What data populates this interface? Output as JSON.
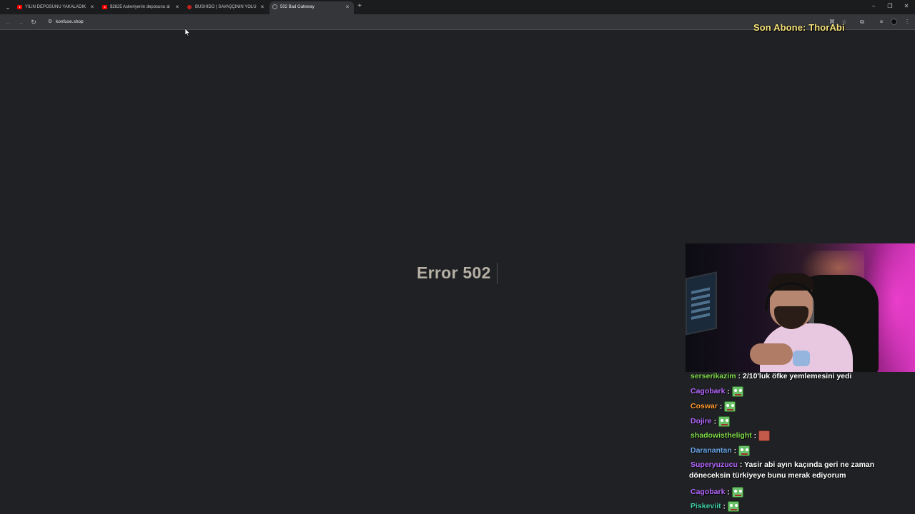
{
  "browser": {
    "tabs": [
      {
        "title": "YILIN DEPOSUNU YAKALADIK /",
        "favicon": "youtube-icon",
        "active": false
      },
      {
        "title": "$2625 Askeriyenin deposunu al",
        "favicon": "youtube-icon",
        "active": false
      },
      {
        "title": "BUSHIDO | SAVAŞÇININ YOLU |",
        "favicon": "red-circle-icon",
        "active": false
      },
      {
        "title": "502 Bad Gateway",
        "favicon": "globe-icon",
        "active": true
      }
    ],
    "new_tab_symbol": "+",
    "tab_close_symbol": "×",
    "address": "konfuse.shop",
    "window_controls": {
      "minimize": "–",
      "restore": "❐",
      "close": "✕"
    }
  },
  "overlay": {
    "sub_banner": "Son Abone: ThorAbi"
  },
  "page": {
    "error_text": "Error 502"
  },
  "chat": {
    "messages": [
      {
        "user": "serserikazim",
        "color": "#7fdc4a",
        "text": "2/10'luk öfke yemlemesini yedi",
        "emote": null
      },
      {
        "user": "Cagobark",
        "color": "#b366ff",
        "text": "",
        "emote": "pepe"
      },
      {
        "user": "Coswar",
        "color": "#ff9a2e",
        "text": "",
        "emote": "pepe"
      },
      {
        "user": "Dojire",
        "color": "#b366ff",
        "text": "",
        "emote": "pepe"
      },
      {
        "user": "shadowisthelight",
        "color": "#7fdc4a",
        "text": "",
        "emote": "meat"
      },
      {
        "user": "Daranantan",
        "color": "#6aa7e8",
        "text": "",
        "emote": "pepe"
      },
      {
        "user": "Superyuzucu",
        "color": "#b366ff",
        "text": "Yasir abi ayın kaçında geri ne zaman",
        "text2": "döneceksin türkiyeye bunu merak ediyorum",
        "emote": null
      },
      {
        "user": "Cagobark",
        "color": "#b366ff",
        "text": "",
        "emote": "pepe"
      },
      {
        "user": "Piskeviit",
        "color": "#3ecfa4",
        "text": "",
        "emote": "pepe"
      }
    ]
  }
}
